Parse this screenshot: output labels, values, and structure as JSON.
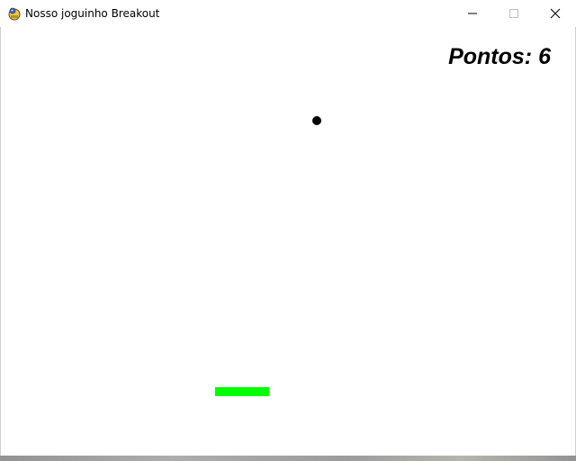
{
  "window": {
    "title": "Nosso joguinho Breakout",
    "icon": "pygame-snake-icon",
    "controls": {
      "minimize_icon": "minimize-icon",
      "maximize_icon": "maximize-icon",
      "close_icon": "close-icon"
    }
  },
  "game": {
    "score_text": "Pontos: 6",
    "paddle_color": "#00ff00",
    "ball_color": "#000000",
    "background_color": "#ffffff"
  }
}
